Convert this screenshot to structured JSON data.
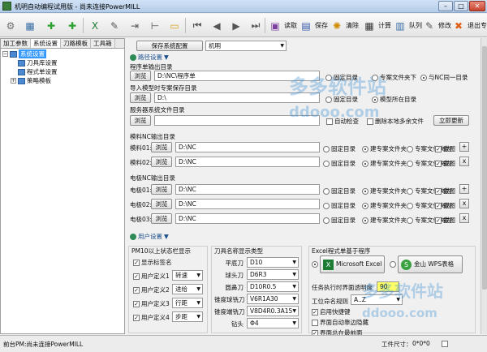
{
  "window": {
    "title": "机明自动编程试用版 - 尚未连接PowerMILL",
    "min": "–",
    "max": "□",
    "close": "✕"
  },
  "toolbar": [
    {
      "name": "settings-gear-icon",
      "glyph": "⚙",
      "color": "#707070",
      "label": ""
    },
    {
      "name": "database-icon",
      "glyph": "▦",
      "color": "#3a6ea5",
      "label": ""
    },
    {
      "name": "add-icon",
      "glyph": "✚",
      "color": "#2ca02c",
      "label": ""
    },
    {
      "name": "add-green-icon",
      "glyph": "✚",
      "color": "#2ca02c",
      "label": ""
    },
    {
      "name": "excel-icon",
      "glyph": "X",
      "color": "#1e7b34",
      "label": ""
    },
    {
      "name": "cut-tool-icon",
      "glyph": "✎",
      "color": "#555",
      "label": ""
    },
    {
      "name": "arrow-into-icon",
      "glyph": "⇥",
      "color": "#555",
      "label": ""
    },
    {
      "name": "tree-icon",
      "glyph": "⊢",
      "color": "#555",
      "label": ""
    },
    {
      "name": "folder-icon",
      "glyph": "▭",
      "color": "#d9a520",
      "label": ""
    },
    {
      "name": "first-icon",
      "glyph": "⏮",
      "color": "#555",
      "label": ""
    },
    {
      "name": "prev-icon",
      "glyph": "◀",
      "color": "#555",
      "label": ""
    },
    {
      "name": "next-icon",
      "glyph": "▶",
      "color": "#555",
      "label": ""
    },
    {
      "name": "last-icon",
      "glyph": "⏭",
      "color": "#555",
      "label": ""
    },
    {
      "name": "read-icon",
      "glyph": "▣",
      "color": "#7b3fa0",
      "label": "读取"
    },
    {
      "name": "save-icon",
      "glyph": "▤",
      "color": "#3056a8",
      "label": "保存"
    },
    {
      "name": "clear-icon",
      "glyph": "✺",
      "color": "#d08a00",
      "label": "清除"
    },
    {
      "name": "calculate-icon",
      "glyph": "▦",
      "color": "#333",
      "label": "计算"
    },
    {
      "name": "queue-icon",
      "glyph": "▥",
      "color": "#3a6ea5",
      "label": "队列"
    },
    {
      "name": "edit-icon",
      "glyph": "✎",
      "color": "#555",
      "label": "修改"
    },
    {
      "name": "exit-icon",
      "glyph": "✖",
      "color": "#e0601a",
      "label": "退出专家"
    }
  ],
  "left": {
    "tabs": [
      "加工参数",
      "系统设置",
      "刀路模板",
      "工具箱"
    ],
    "active_tab": 1,
    "tree": [
      {
        "label": "系统设置",
        "expander": "−",
        "selected": true
      },
      {
        "label": "刀具库设置",
        "expander": "",
        "selected": false
      },
      {
        "label": "程式单设置",
        "expander": "",
        "selected": false
      },
      {
        "label": "策略模板",
        "expander": "+",
        "selected": false
      }
    ]
  },
  "top": {
    "save_button": "保存系统配置",
    "profile": "机明"
  },
  "path_section": {
    "title": "路径设置",
    "arrow": "▼",
    "program_dir_label": "程序单输出目录",
    "browse": "浏览",
    "program_dir_value": "D:\\NC\\程序单",
    "program_radios": [
      "固定目录",
      "专案文件夹下",
      "与NC同一目录"
    ],
    "program_selected": 2,
    "import_label": "导入模型时专案保存目录",
    "import_value": "D:\\",
    "import_radios": [
      "固定目录",
      "模型所在目录"
    ],
    "import_selected": 1,
    "server_label": "服务器系统文件目录",
    "server_value": "",
    "auto_check": "自动检查",
    "delete_extra": "删除本地多余文件",
    "update_now": "立即更新",
    "mold_label": "模料NC输出目录",
    "mold_rows": [
      {
        "name": "模料01:",
        "value": "D:\\NC",
        "btn": "+"
      },
      {
        "name": "模料02:",
        "value": "D:\\NC",
        "btn": "x"
      }
    ],
    "electrode_label": "电极NC输出目录",
    "electrode_rows": [
      {
        "name": "电极01:",
        "value": "D:\\NC",
        "btn": "+"
      },
      {
        "name": "电极02:",
        "value": "D:\\NC",
        "btn": "x"
      },
      {
        "name": "电极03:",
        "value": "D:\\NC",
        "btn": "x"
      }
    ],
    "row_radios": [
      "固定目录",
      "建专案文件夹",
      "专案文件夹内"
    ],
    "row_selected": 1,
    "screenshot": "截图"
  },
  "user_section": {
    "title": "用户设置",
    "arrow": "▼",
    "pm_title": "PM10以上状态栏显示",
    "show_label": "显示标签名",
    "custom": [
      {
        "label": "用户定义1",
        "value": "转速"
      },
      {
        "label": "用户定义2",
        "value": "进给"
      },
      {
        "label": "用户定义3",
        "value": "行距"
      },
      {
        "label": "用户定义4",
        "value": "步距"
      }
    ],
    "tool_title": "刀具名称显示类型",
    "tools": [
      {
        "label": "平底刀",
        "value": "D10"
      },
      {
        "label": "球头刀",
        "value": "D6R3"
      },
      {
        "label": "圆鼻刀",
        "value": "D10R0.5"
      },
      {
        "label": "锥度球铣刀",
        "value": "V6R1A30"
      },
      {
        "label": "锥度端铣刀",
        "value": "V8D4R0.3A15"
      },
      {
        "label": "钻头",
        "value": "Φ4"
      }
    ],
    "excel_title": "Excel程式单基于程序",
    "excel_btn": "Microsoft Excel",
    "wps_btn": "金山 WPS表格",
    "excel_selected": 0,
    "transparency_label": "任务执行时界面透明度",
    "transparency_value": "90",
    "process_label": "工位命名规则",
    "process_value": "A..Z",
    "quick_key": "启用快捷键",
    "auto_hide": "界面自动靠边隐藏",
    "always_top": "界面总在最前面"
  },
  "status": {
    "left": "前台PM:尚未连接PowerMILL",
    "size_label": "工件尺寸：",
    "size_value": "0*0*0"
  },
  "watermark": {
    "text1": "多多软件站",
    "text2": "ddooo.com"
  }
}
